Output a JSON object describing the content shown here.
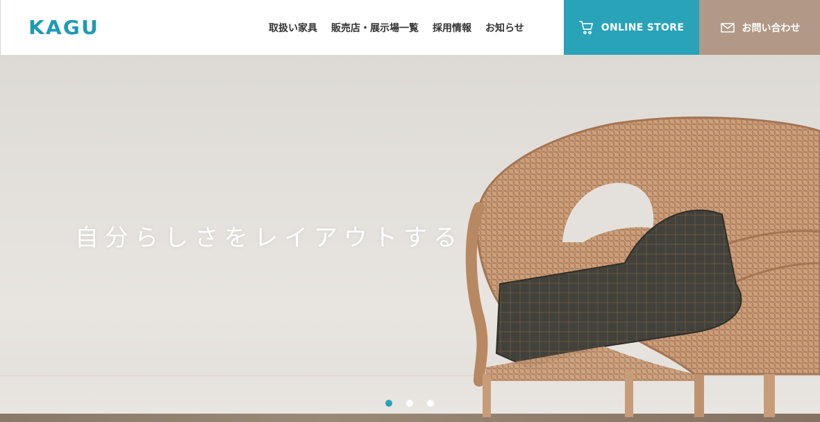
{
  "brand": {
    "logo_text": "KAGU",
    "logo_color": "#1e9bb3"
  },
  "nav": {
    "items": [
      {
        "label": "取扱い家具"
      },
      {
        "label": "販売店・展示場一覧"
      },
      {
        "label": "採用情報"
      },
      {
        "label": "お知らせ"
      }
    ]
  },
  "actions": {
    "online_store": {
      "label": "ONLINE STORE",
      "icon": "cart-icon",
      "color": "#28a3b8"
    },
    "contact": {
      "label": "お問い合わせ",
      "icon": "mail-icon",
      "color": "#b29987"
    }
  },
  "hero": {
    "tagline": "自分らしさをレイアウトする",
    "slides": {
      "count": 3,
      "active_index": 0
    }
  }
}
